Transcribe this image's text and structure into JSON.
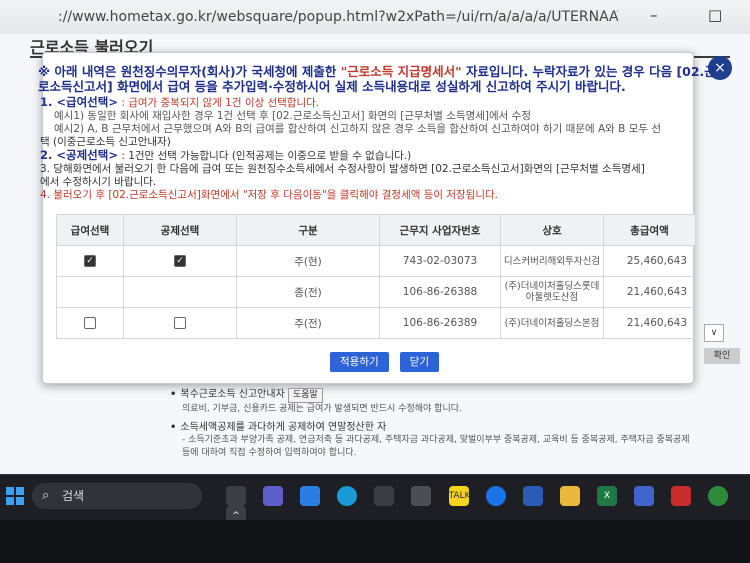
{
  "browser": {
    "url": "://www.hometax.go.kr/websquare/popup.html?w2xPath=/ui/rn/a/a/a/a/UTERNAAT18.xml&popupID=UTERN...",
    "minimize": "–",
    "maximize": "□"
  },
  "page": {
    "title": "근로소득 불러오기"
  },
  "modal": {
    "close_label": "×",
    "notice_head": {
      "prefix": "※ 아래 내역은 원천징수의무자(회사)가 국세청에 제출한 ",
      "quoted": "\"근로소득 지급명세서\"",
      "suffix": " 자료입니다. 누락자료가 있는 경우 다음 [02.근",
      "line2": "로소득신고서] 화면에서 급여 등을 추가입력·수정하시어 실제 소득내용대로 성실하게 신고하여 주시기 바랍니다."
    },
    "notes": {
      "n1_title": "1. <급여선택>",
      "n1_text": ": 급여가 중복되지 않게 1건 이상 선택합니다.",
      "n1_ex1": "예시1) 동일한 회사에 재입사한 경우 1건 선택 후 [02.근로소득신고서] 화면의 [근무처별 소득명세]에서 수정",
      "n1_ex2": "예시2) A, B 근무처에서 근무했으며 A와 B의 급여를 합산하여 신고하지 않은 경우 소득을 합산하여 신고하여야 하기 때문에 A와 B 모두 선",
      "n1_ex2b": "택 (이중근로소득 신고안내자)",
      "n2_title": "2. <공제선택>",
      "n2_text": ": 1건만 선택 가능합니다 (인적공제는 이중으로 받을 수 없습니다.)",
      "n3_text": "3. 당해화면에서 불러오기 한 다음에 급여 또는 원천징수소득세에서 수정사항이 발생하면 [02.근로소득신고서]화면의 [근무처별 소득명세]",
      "n3b_text": "에서 수정하시기 바랍니다.",
      "n4_text": "4. 불러오기 후 [02.근로소득신고서]화면에서 \"저장 후 다음이동\"을 클릭해야 결정세액 등이 저장됩니다."
    },
    "table": {
      "headers": [
        "급여선택",
        "공제선택",
        "구분",
        "근무지 사업자번호",
        "상호",
        "총급여액"
      ],
      "rows": [
        {
          "pay_checked": true,
          "deduct_checked": true,
          "type": "주(현)",
          "bizno": "743-02-03073",
          "name": "디스커버리해외투자신검",
          "total": "25,460,643"
        },
        {
          "pay_checked": false,
          "deduct_checked": false,
          "type": "종(전)",
          "bizno": "106-86-26388",
          "name": "(주)더네이처홀딩스롯데아울렛도산점",
          "total": "21,460,643"
        },
        {
          "pay_checked": false,
          "deduct_checked": false,
          "type": "주(전)",
          "bizno": "106-86-26389",
          "name": "(주)더네이처홀딩스본점",
          "total": "21,460,643"
        }
      ]
    },
    "buttons": {
      "apply": "적용하기",
      "close": "닫기"
    }
  },
  "side": {
    "select": "∨",
    "button": "확인"
  },
  "below": {
    "l1_text": "복수근로소득 신고안내자",
    "l1_tag": "도움말",
    "l1_sub": "의료비, 기부금, 신용카드 공제는 급여가 발생되면 반드시 수정해야 합니다.",
    "l2_text": "소득세액공제를 과다하게 공제하여 연말정산한 자",
    "l2_sub": "- 소득기준초과 부양가족 공제, 연금저축 등 과다공제, 주택자금 과다공제, 맞벌이부부 중복공제, 교육비 등 중복공제, 주택자금 중복공제",
    "l2_sub2": "등에 대하여 직접 수정하여 입력하여야 합니다."
  },
  "taskbar": {
    "search_text": "검색",
    "icons": [
      "file-explorer-icon",
      "camera-icon",
      "teams-icon",
      "edge-icon",
      "store-icon",
      "photos-icon",
      "kakaotalk-icon",
      "chrome-icon",
      "hancom-icon",
      "folder-icon",
      "excel-icon",
      "media-icon",
      "red-app-icon",
      "xbox-icon",
      "more-icon"
    ]
  }
}
